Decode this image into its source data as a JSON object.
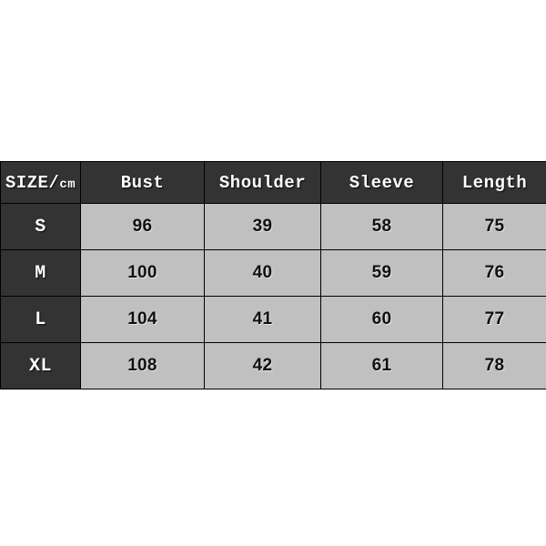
{
  "chart_data": {
    "type": "table",
    "title": "SIZE/cm",
    "unit": "cm",
    "columns": [
      "SIZE/cm",
      "Bust",
      "Shoulder",
      "Sleeve",
      "Length"
    ],
    "size_header": {
      "main": "SIZE/",
      "unit": "cm",
      "full": "SIZE/cm"
    },
    "measurement_headers": [
      "Bust",
      "Shoulder",
      "Sleeve",
      "Length"
    ],
    "rows": [
      {
        "size": "S",
        "bust": "96",
        "shoulder": "39",
        "sleeve": "58",
        "length": "75"
      },
      {
        "size": "M",
        "bust": "100",
        "shoulder": "40",
        "sleeve": "59",
        "length": "76"
      },
      {
        "size": "L",
        "bust": "104",
        "shoulder": "41",
        "sleeve": "60",
        "length": "77"
      },
      {
        "size": "XL",
        "bust": "108",
        "shoulder": "42",
        "sleeve": "61",
        "length": "78"
      }
    ],
    "series": [
      {
        "name": "Bust",
        "values": [
          96,
          100,
          104,
          108
        ]
      },
      {
        "name": "Shoulder",
        "values": [
          39,
          40,
          41,
          42
        ]
      },
      {
        "name": "Sleeve",
        "values": [
          58,
          59,
          60,
          61
        ]
      },
      {
        "name": "Length",
        "values": [
          75,
          76,
          77,
          78
        ]
      }
    ],
    "categories": [
      "S",
      "M",
      "L",
      "XL"
    ],
    "colors": {
      "header_background": "#333333",
      "header_text": "#ffffff",
      "cell_background": "#c0c0c0",
      "cell_text": "#101010",
      "grid_line": "#000000",
      "page_background": "#ffffff"
    }
  }
}
